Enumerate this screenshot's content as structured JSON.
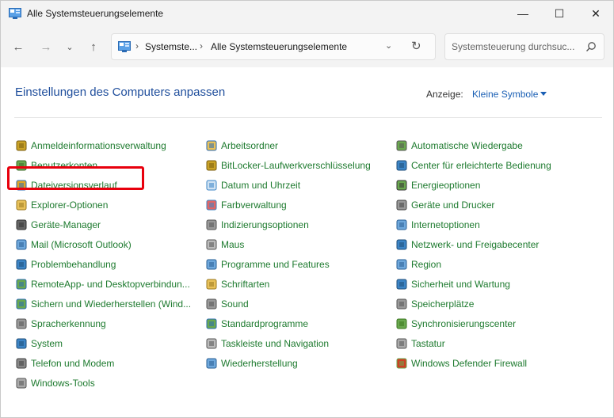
{
  "window": {
    "title": "Alle Systemsteuerungselemente",
    "controls": {
      "minimize": "—",
      "maximize": "☐",
      "close": "✕"
    }
  },
  "nav": {
    "back": "←",
    "forward": "→",
    "recent": "⌄",
    "up": "↑",
    "address": {
      "segments": [
        "Systemste...",
        "Alle Systemsteuerungselemente"
      ],
      "separator": "›",
      "dropdown": "⌄",
      "refresh": "↻"
    },
    "search": {
      "placeholder": "Systemsteuerung durchsuc..."
    }
  },
  "header": {
    "title": "Einstellungen des Computers anpassen",
    "view_label": "Anzeige:",
    "view_value": "Kleine Symbole"
  },
  "colors": {
    "link": "#1d7a2e",
    "title": "#1f4e9c",
    "accent": "#1a5fb4",
    "highlight": "#e8000d"
  },
  "columns": [
    {
      "items": [
        {
          "label": "Anmeldeinformationsverwaltung",
          "icon": "credential-manager-icon"
        },
        {
          "label": "Benutzerkonten",
          "icon": "user-accounts-icon"
        },
        {
          "label": "Dateiversionsverlauf",
          "icon": "file-history-icon"
        },
        {
          "label": "Explorer-Optionen",
          "icon": "explorer-options-icon"
        },
        {
          "label": "Geräte-Manager",
          "icon": "device-manager-icon"
        },
        {
          "label": "Mail (Microsoft Outlook)",
          "icon": "mail-icon"
        },
        {
          "label": "Problembehandlung",
          "icon": "troubleshooting-icon"
        },
        {
          "label": "RemoteApp- und Desktopverbindun...",
          "icon": "remoteapp-icon"
        },
        {
          "label": "Sichern und Wiederherstellen (Wind...",
          "icon": "backup-restore-icon"
        },
        {
          "label": "Spracherkennung",
          "icon": "speech-recognition-icon"
        },
        {
          "label": "System",
          "icon": "system-icon"
        },
        {
          "label": "Telefon und Modem",
          "icon": "phone-modem-icon"
        },
        {
          "label": "Windows-Tools",
          "icon": "windows-tools-icon"
        }
      ]
    },
    {
      "items": [
        {
          "label": "Arbeitsordner",
          "icon": "work-folders-icon"
        },
        {
          "label": "BitLocker-Laufwerkverschlüsselung",
          "icon": "bitlocker-icon"
        },
        {
          "label": "Datum und Uhrzeit",
          "icon": "date-time-icon"
        },
        {
          "label": "Farbverwaltung",
          "icon": "color-management-icon"
        },
        {
          "label": "Indizierungsoptionen",
          "icon": "indexing-options-icon"
        },
        {
          "label": "Maus",
          "icon": "mouse-icon"
        },
        {
          "label": "Programme und Features",
          "icon": "programs-features-icon"
        },
        {
          "label": "Schriftarten",
          "icon": "fonts-icon"
        },
        {
          "label": "Sound",
          "icon": "sound-icon"
        },
        {
          "label": "Standardprogramme",
          "icon": "default-programs-icon"
        },
        {
          "label": "Taskleiste und Navigation",
          "icon": "taskbar-icon"
        },
        {
          "label": "Wiederherstellung",
          "icon": "recovery-icon"
        }
      ]
    },
    {
      "items": [
        {
          "label": "Automatische Wiedergabe",
          "icon": "autoplay-icon"
        },
        {
          "label": "Center für erleichterte Bedienung",
          "icon": "ease-of-access-icon"
        },
        {
          "label": "Energieoptionen",
          "icon": "power-options-icon"
        },
        {
          "label": "Geräte und Drucker",
          "icon": "devices-printers-icon"
        },
        {
          "label": "Internetoptionen",
          "icon": "internet-options-icon"
        },
        {
          "label": "Netzwerk- und Freigabecenter",
          "icon": "network-sharing-icon"
        },
        {
          "label": "Region",
          "icon": "region-icon"
        },
        {
          "label": "Sicherheit und Wartung",
          "icon": "security-maintenance-icon"
        },
        {
          "label": "Speicherplätze",
          "icon": "storage-spaces-icon"
        },
        {
          "label": "Synchronisierungscenter",
          "icon": "sync-center-icon"
        },
        {
          "label": "Tastatur",
          "icon": "keyboard-icon"
        },
        {
          "label": "Windows Defender Firewall",
          "icon": "firewall-icon"
        }
      ]
    }
  ]
}
